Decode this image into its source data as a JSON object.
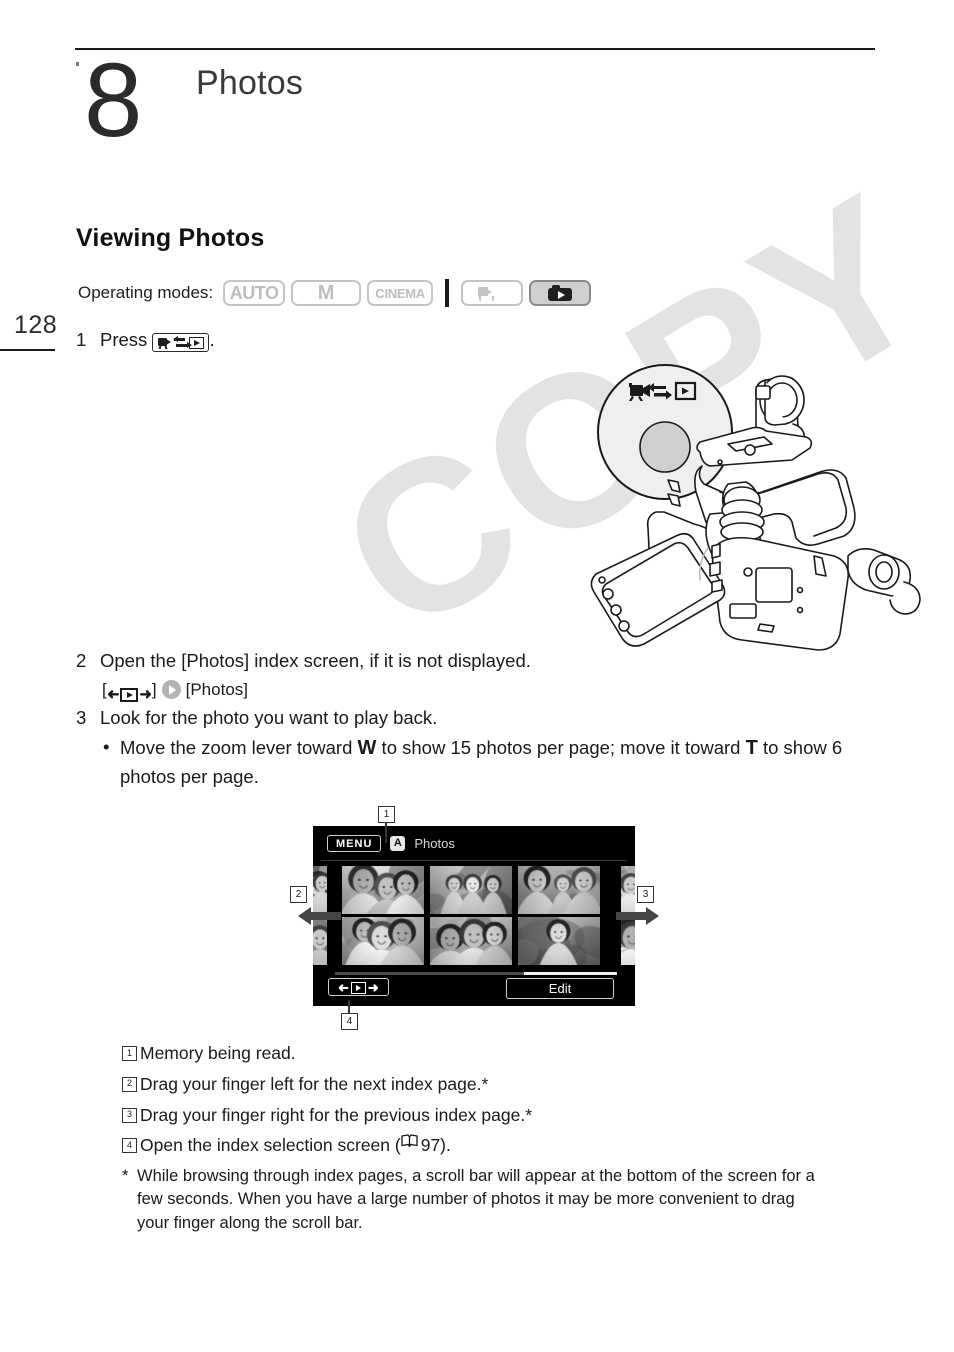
{
  "page": {
    "number": "128",
    "watermark": "COPY"
  },
  "chapter": {
    "number": "8",
    "title": "Photos"
  },
  "section": {
    "heading": "Viewing Photos"
  },
  "operating_modes": {
    "label": "Operating modes:",
    "badges": [
      {
        "name": "auto",
        "label": "AUTO",
        "active": false
      },
      {
        "name": "manual",
        "label": "M",
        "active": false
      },
      {
        "name": "cinema",
        "label": "CINEMA",
        "active": false
      },
      {
        "name": "movie-playback",
        "label": "movie-playback-icon",
        "active": false
      },
      {
        "name": "photo-playback",
        "label": "photo-playback-icon",
        "active": true
      }
    ]
  },
  "steps": {
    "step1": {
      "num": "1",
      "text_before": "Press",
      "icon": "camera-playback-toggle-icon",
      "text_after": "."
    },
    "step2": {
      "num": "2",
      "text": "Open the [Photos] index screen, if it is not displayed."
    },
    "step2_sub": {
      "bracket_open": "[",
      "icon": "index-selection-icon",
      "bracket_close": "]",
      "target": "[Photos]"
    },
    "step3": {
      "num": "3",
      "text": "Look for the photo you want to play back."
    },
    "step3_bullet": {
      "part1": "Move the zoom lever toward ",
      "wide": "W",
      "part2": " to show 15 photos per page; move it toward ",
      "tele": "T",
      "part3": " to show 6 photos per page."
    }
  },
  "camera_screen": {
    "menu_label": "MENU",
    "memory_badge": "A",
    "title": "Photos",
    "edit_label": "Edit",
    "index_select_icon": "index-selection-icon",
    "scrollbar_visible": true
  },
  "callouts": {
    "one": "1",
    "two": "2",
    "three": "3",
    "four": "4"
  },
  "notes": [
    {
      "num": "1",
      "text": "Memory being read."
    },
    {
      "num": "2",
      "text": "Drag your finger left for the next index page.*"
    },
    {
      "num": "3",
      "text": "Drag your finger right for the previous index page.*"
    },
    {
      "num": "4",
      "text_before": "Open the index selection screen (",
      "book_icon": "book-icon",
      "page_ref": " 97).",
      "text_after": ""
    }
  ],
  "footnote": {
    "marker": "*",
    "text": "While browsing through index pages, a scroll bar will appear at the bottom of the screen for a few seconds. When you have a large number of photos it may be more convenient to drag your finger along the scroll bar."
  },
  "colors": {
    "text": "#1a1a1a",
    "muted_badge": "#bdbdbd",
    "active_badge_bg": "#d0d0d0",
    "watermark": "#e3e3e3",
    "screen_bg": "#000000"
  }
}
